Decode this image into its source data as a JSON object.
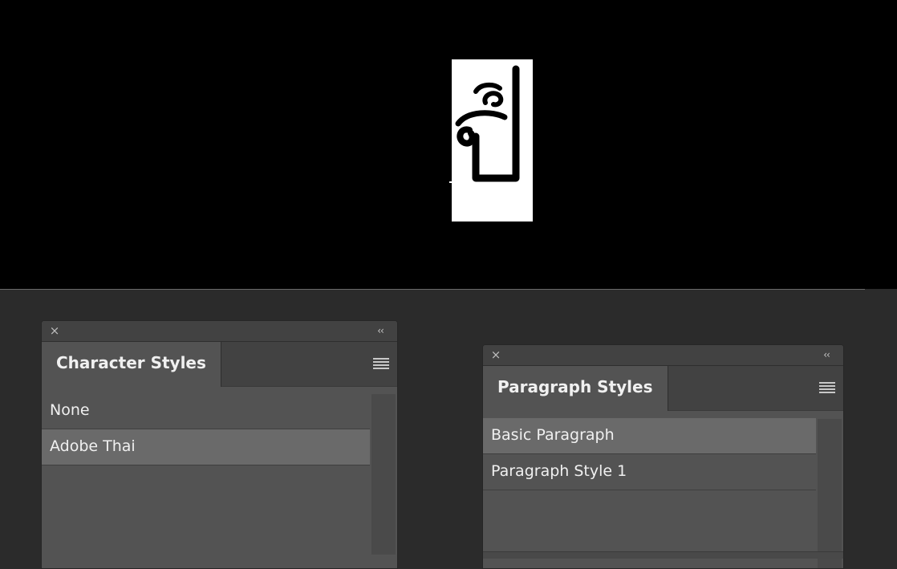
{
  "canvas": {
    "glyph_text": "ปี๊"
  },
  "character_styles_panel": {
    "tab_label": "Character Styles",
    "close_glyph": "×",
    "collapse_glyph": "‹‹",
    "items": [
      {
        "label": "None",
        "selected": false
      },
      {
        "label": "Adobe Thai",
        "selected": true
      }
    ]
  },
  "paragraph_styles_panel": {
    "tab_label": "Paragraph Styles",
    "close_glyph": "×",
    "collapse_glyph": "‹‹",
    "items": [
      {
        "label": "Basic Paragraph",
        "selected": true
      },
      {
        "label": "Paragraph Style 1",
        "selected": false
      }
    ]
  }
}
